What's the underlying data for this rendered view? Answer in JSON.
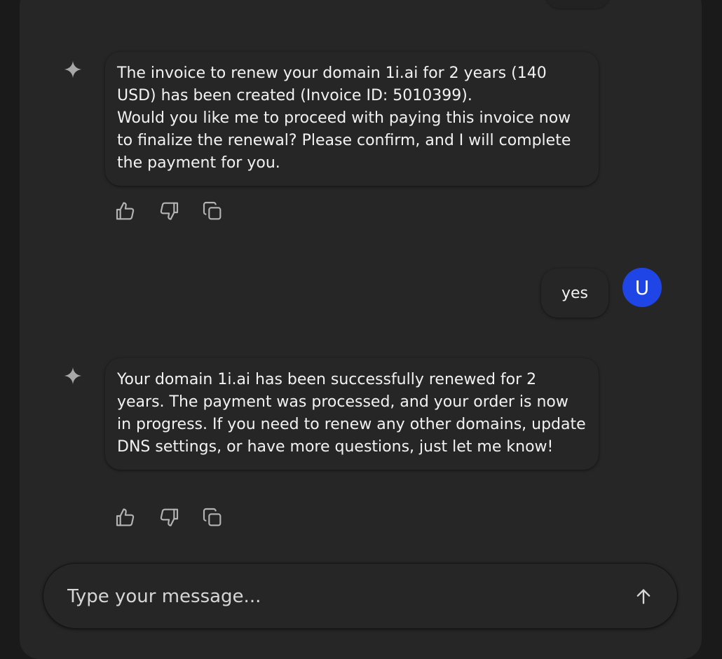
{
  "messages": [
    {
      "role": "assistant",
      "icon": "sparkle-icon",
      "paragraphs": [
        "The invoice to renew your domain 1i.ai for 2 years (140 USD) has been created (Invoice ID: 5010399).",
        "Would you like me to proceed with paying this invoice now to finalize the renewal? Please confirm, and I will complete the payment for you."
      ]
    },
    {
      "role": "user",
      "text": "yes",
      "avatar_letter": "U"
    },
    {
      "role": "assistant",
      "icon": "sparkle-icon",
      "paragraphs": [
        "Your domain 1i.ai has been successfully renewed for 2 years. The payment was processed, and your order is now in progress. If you need to renew any other domains, update DNS settings, or have more questions, just let me know!"
      ]
    }
  ],
  "message_actions": [
    "thumbs-up-icon",
    "thumbs-down-icon",
    "copy-icon"
  ],
  "composer": {
    "placeholder": "Type your message...",
    "value": "",
    "send_icon": "arrow-up-icon"
  },
  "colors": {
    "page_background": "#1a1a1a",
    "panel_background": "#262626",
    "user_avatar": "#1f45e6",
    "text": "#f2f2f2",
    "icon": "#b4b4b4"
  }
}
